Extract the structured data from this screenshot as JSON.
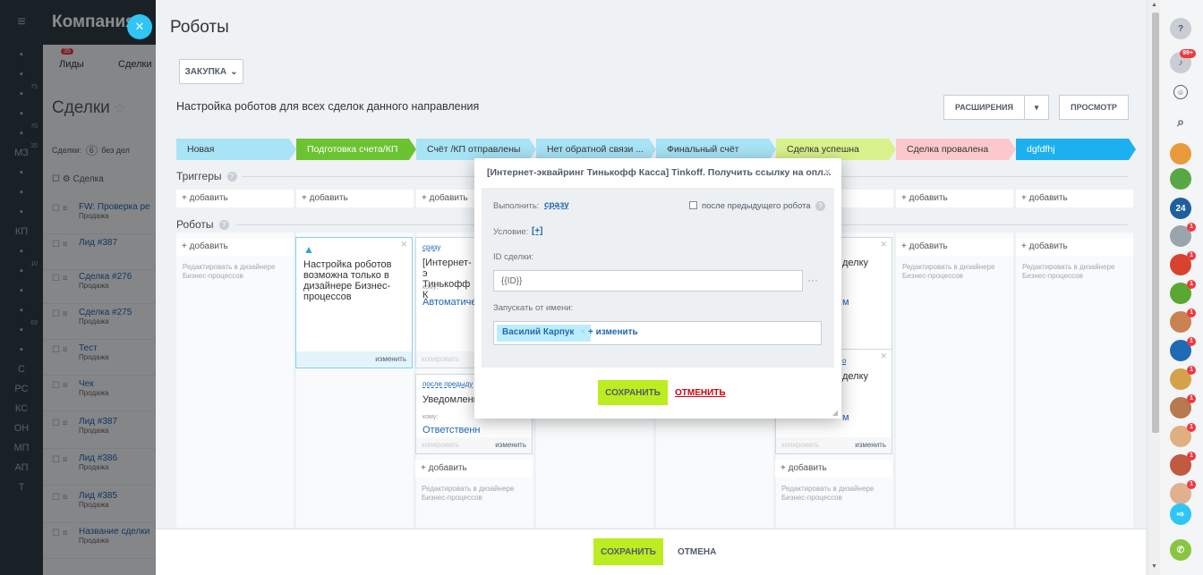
{
  "left_nav": {
    "items": [
      "",
      "",
      "",
      "",
      "",
      "МЗ",
      "",
      "",
      "",
      "КП",
      "",
      "",
      "",
      "",
      "",
      "",
      "С",
      "РС",
      "КС",
      "ОН",
      "МП",
      "АП",
      "Т"
    ],
    "sups": {
      "2": "75",
      "4": "70",
      "5": "35",
      "11": "10",
      "14": "69"
    }
  },
  "background": {
    "company": "Компания",
    "tabs": {
      "leads": "Лиды",
      "deals": "Сделки",
      "leads_badge": "35"
    },
    "deals_title": "Сделки",
    "filter": "Сделки:",
    "filter_badge": "6",
    "filter_rest": "без дел",
    "column_header": "Сделка",
    "rows": [
      {
        "t": "FW: Проверка ре",
        "s": "Продажа"
      },
      {
        "t": "Лид #387",
        "s": ""
      },
      {
        "t": "Сделка #276",
        "s": "Продажа"
      },
      {
        "t": "Сделка #275",
        "s": "Продажа"
      },
      {
        "t": "Тест",
        "s": "Продажа"
      },
      {
        "t": "Чек",
        "s": "Продажа"
      },
      {
        "t": "Лид #387",
        "s": "Продажа"
      },
      {
        "t": "Лид #386",
        "s": "Продажа"
      },
      {
        "t": "Лид #385",
        "s": "Продажа"
      },
      {
        "t": "Название сделки",
        "s": "Продажа"
      }
    ]
  },
  "slider": {
    "title": "Роботы",
    "category": "ЗАКУПКА",
    "subtitle": "Настройка роботов для всех сделок данного направления",
    "ext_button": "РАСШИРЕНИЯ",
    "preview_button": "ПРОСМОТР",
    "triggers": "Триггеры",
    "robots": "Роботы",
    "add": "+ добавить",
    "designer_hint": "Редактировать в дизайнере Бизнес-процессов"
  },
  "stages": [
    {
      "name": "Новая",
      "color": "#a8e3f6"
    },
    {
      "name": "Подготовка счета/КП",
      "color": "#6cc331"
    },
    {
      "name": "Счёт /КП отправлены",
      "color": "#a8e3f6"
    },
    {
      "name": "Нет обратной связи ...",
      "color": "#a8e3f6"
    },
    {
      "name": "Финальный счёт",
      "color": "#a8e3f6"
    },
    {
      "name": "Сделка успешна",
      "color": "#d9f28c"
    },
    {
      "name": "Сделка провалена",
      "color": "#fbc9cd"
    },
    {
      "name": "dgfdfhj",
      "color": "#1cb0f0"
    }
  ],
  "cards": {
    "warn": "Настройка роботов возможна только в дизайнере Бизнес-процессов",
    "change": "изменить",
    "copy": "копировать",
    "c1_exec": "сразу",
    "c1_title": "[Интернет-э Тинькофф К",
    "c1_to": "кому:",
    "c1_person": "Автоматичес",
    "c2_exec": "после предыду",
    "c2_title": "Уведомлени",
    "c2_to": "кому:",
    "c2_person": "Ответственн",
    "r1_title": "делку",
    "r1_exec": "о",
    "r2_title": "делку",
    "r2_extra": "м",
    "r1_extra": "м"
  },
  "modal": {
    "title": "[Интернет-эквайринг Тинькофф Касса] Tinkoff. Получить ссылку на опл...",
    "exec_label": "Выполнить:",
    "exec_value": "сразу",
    "after_prev": "после предыдущего робота",
    "condition_label": "Условие:",
    "condition_value": "[+]",
    "deal_id_label": "ID сделки:",
    "deal_id_value": "{{ID}}",
    "run_as_label": "Запускать от имени:",
    "user": "Василий Карпук",
    "change_user": "+ изменить",
    "save": "СОХРАНИТЬ",
    "cancel": "ОТМЕНИТЬ"
  },
  "bottom": {
    "save": "СОХРАНИТЬ",
    "cancel": "ОТМЕНА"
  },
  "right_bar": {
    "badge_notif": "99+",
    "counter": "24"
  }
}
